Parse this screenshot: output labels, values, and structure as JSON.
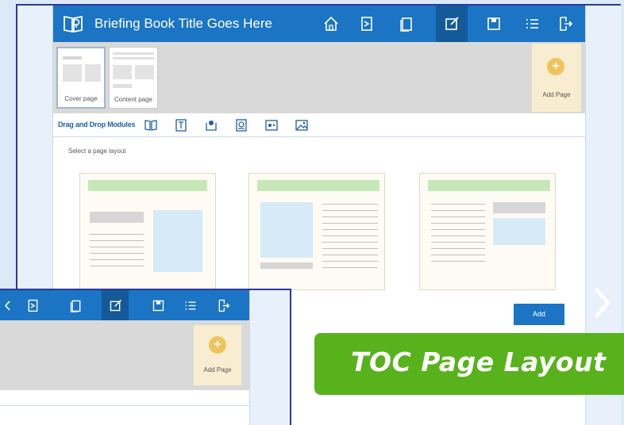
{
  "app": {
    "title": "Briefing Book Title Goes Here",
    "brand_color": "#1b74c4",
    "nav_icons": [
      "home-icon",
      "bookmark-icon",
      "pages-icon",
      "edit-icon",
      "save-icon",
      "list-icon",
      "exit-icon"
    ],
    "active_nav": "edit-icon"
  },
  "pages": {
    "thumbnails": [
      {
        "label": "Cover page",
        "selected": true
      },
      {
        "label": "Content page",
        "selected": false
      }
    ],
    "add_page_label": "Add Page"
  },
  "modules": {
    "label": "Drag and Drop Modules",
    "icons": [
      "book-icon",
      "text-icon",
      "image-pin-icon",
      "video-icon",
      "toggle-icon",
      "photo-icon"
    ]
  },
  "layout": {
    "prompt": "Select a page layout",
    "options": [
      "layout-image-right",
      "layout-image-left",
      "layout-image-top-right"
    ],
    "add_button": "Add"
  },
  "overlay": {
    "add_page_label": "Add Page"
  },
  "badge": {
    "text": "TOC Page Layout",
    "color": "#58b21c"
  }
}
